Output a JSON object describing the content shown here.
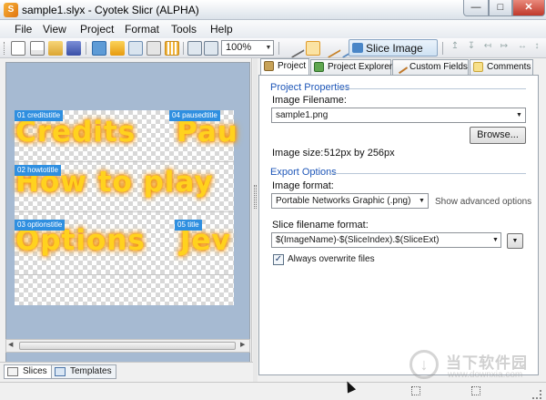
{
  "window": {
    "title": "sample1.slyx - Cyotek Slicr (ALPHA)",
    "app_icon_glyph": "S",
    "minimize_glyph": "—",
    "maximize_glyph": "□",
    "close_glyph": "✕"
  },
  "menu": [
    "File",
    "View",
    "Project",
    "Format",
    "Tools",
    "Help"
  ],
  "toolbar": {
    "zoom": "100%",
    "slice_image_label": "Slice Image"
  },
  "canvas": {
    "slices": [
      {
        "label": "01 creditstitle",
        "text": "Credits"
      },
      {
        "label": "04 pausedtitle",
        "text": "Pau"
      },
      {
        "label": "02 howtotitle",
        "text": "How to play"
      },
      {
        "label": "03 optionstitle",
        "text": "Options"
      },
      {
        "label": "05 title",
        "text": "Jev"
      }
    ]
  },
  "bottom_tabs": {
    "slices": "Slices",
    "templates": "Templates"
  },
  "tabs": {
    "project": "Project",
    "project_explorer": "Project Explorer",
    "custom_fields": "Custom Fields",
    "comments": "Comments"
  },
  "project_properties": {
    "header": "Project Properties",
    "image_filename_label": "Image Filename:",
    "image_filename_value": "sample1.png",
    "browse_label": "Browse...",
    "image_size_label": "Image size:",
    "image_size_value": "512px by 256px"
  },
  "export_options": {
    "header": "Export Options",
    "image_format_label": "Image format:",
    "image_format_value": "Portable Networks Graphic (.png)",
    "show_advanced_label": "Show advanced options",
    "slice_filename_label": "Slice filename format:",
    "slice_filename_value": "$(ImageName)-$(SliceIndex).$(SliceExt)",
    "overwrite_label": "Always overwrite files",
    "overwrite_checked": true
  },
  "watermark": {
    "cn": "当下软件园",
    "url": "www.downxia.com"
  },
  "colors": {
    "accent_blue": "#2f8fe0",
    "slice_text_yellow": "#ffd21e",
    "group_header_blue": "#1f57b8",
    "canvas_background": "#a6bad2"
  }
}
